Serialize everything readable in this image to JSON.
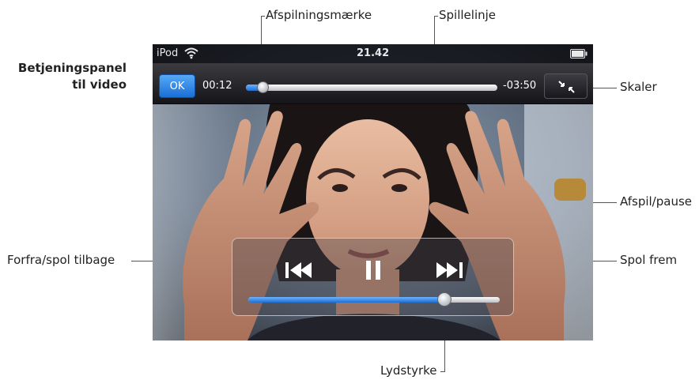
{
  "callouts": {
    "heading": [
      "Betjeningspanel",
      "til video"
    ],
    "playhead": "Afspilningsmærke",
    "scrubber": "Spillelinje",
    "scale": "Skaler",
    "play_pause": "Afspil/pause",
    "previous": "Forfra/spol tilbage",
    "next": "Spol frem",
    "volume": "Lydstyrke"
  },
  "status_bar": {
    "carrier": "iPod",
    "time": "21.42",
    "wifi_icon": "wifi-icon",
    "battery_icon": "battery-icon"
  },
  "top_bar": {
    "done_label": "OK",
    "elapsed": "00:12",
    "remaining": "-03:50",
    "playback_progress": 0.05,
    "scale_icon": "shrink-arrows-icon"
  },
  "controls": {
    "previous_icon": "previous-track-icon",
    "play_pause_icon": "pause-icon",
    "next_icon": "next-track-icon",
    "volume_level": 0.78
  },
  "colors": {
    "accent_blue": "#2b84e6",
    "callout_line": "#555555"
  }
}
